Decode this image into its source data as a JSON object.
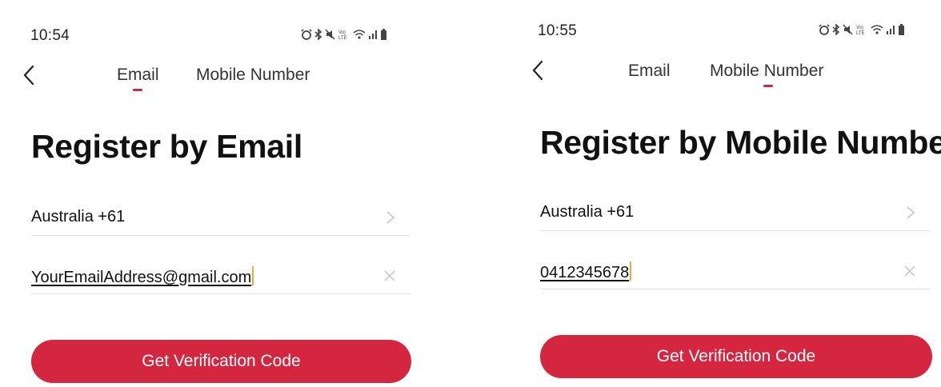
{
  "screens": [
    {
      "status": {
        "time": "10:54"
      },
      "tabs": [
        {
          "label": "Email",
          "active": true
        },
        {
          "label": "Mobile Number",
          "active": false
        }
      ],
      "heading": "Register by Email",
      "country_field": {
        "value": "Australia +61"
      },
      "input_field": {
        "value": "YourEmailAddress@gmail.com"
      },
      "button_label": "Get Verification Code"
    },
    {
      "status": {
        "time": "10:55"
      },
      "tabs": [
        {
          "label": "Email",
          "active": false
        },
        {
          "label": "Mobile Number",
          "active": true
        }
      ],
      "heading": "Register by Mobile Number",
      "country_field": {
        "value": "Australia +61"
      },
      "input_field": {
        "value": "0412345678"
      },
      "button_label": "Get Verification Code"
    }
  ],
  "icons": {
    "back": "chevron-left-icon",
    "country_arrow": "chevron-right-icon",
    "clear": "close-icon",
    "status": [
      "alarm-icon",
      "bluetooth-icon",
      "mute-icon",
      "volte-icon",
      "wifi-icon",
      "signal-icon",
      "battery-icon"
    ]
  },
  "colors": {
    "accent": "#d4263f",
    "caret": "#f0a63a",
    "divider": "#e2e2e2"
  }
}
